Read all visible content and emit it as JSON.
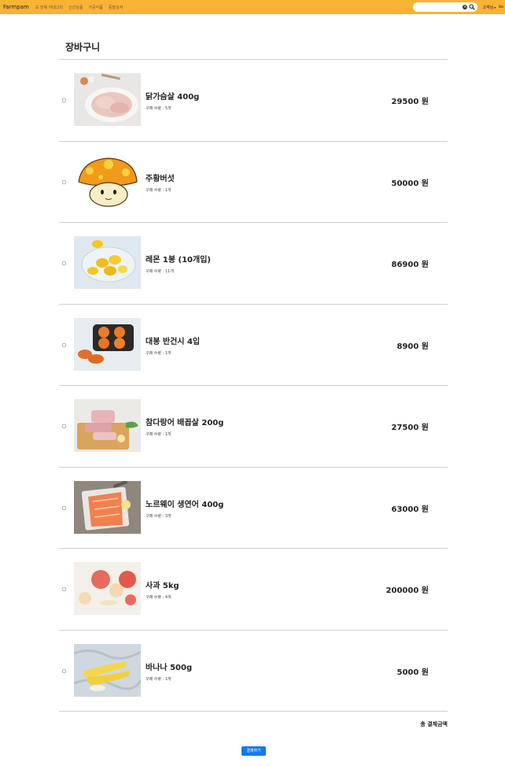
{
  "nav": {
    "brand": "Farmpam",
    "links": [
      "☰ 전체 카테고리",
      "신선상품",
      "가공식품",
      "중말상자"
    ],
    "search_placeholder": "",
    "clear_icon": "clear-icon",
    "search_icon": "search-icon",
    "user_label": "고객님",
    "lang": "ko"
  },
  "cart": {
    "title": "장바구니",
    "items": [
      {
        "name": "닭가슴살 400g",
        "qty": "구매 수량 : 5개",
        "price": "29500 원",
        "image": "chicken-breast"
      },
      {
        "name": "주황버섯",
        "qty": "구매 수량 : 1개",
        "price": "50000 원",
        "image": "orange-mushroom"
      },
      {
        "name": "레몬 1봉 (10개입)",
        "qty": "구매 수량 : 11개",
        "price": "86900 원",
        "image": "lemons"
      },
      {
        "name": "대봉 반건시 4입",
        "qty": "구매 수량 : 1개",
        "price": "8900 원",
        "image": "persimmons"
      },
      {
        "name": "참다랑어 배꼽살 200g",
        "qty": "구매 수량 : 1개",
        "price": "27500 원",
        "image": "tuna"
      },
      {
        "name": "노르웨이 생연어 400g",
        "qty": "구매 수량 : 3개",
        "price": "63000 원",
        "image": "salmon"
      },
      {
        "name": "사과 5kg",
        "qty": "구매 수량 : 4개",
        "price": "200000 원",
        "image": "apples"
      },
      {
        "name": "바나나 500g",
        "qty": "구매 수량 : 1개",
        "price": "5000 원",
        "image": "bananas"
      }
    ],
    "total_label": "총 결제금액",
    "pay_button": "결제하기"
  }
}
